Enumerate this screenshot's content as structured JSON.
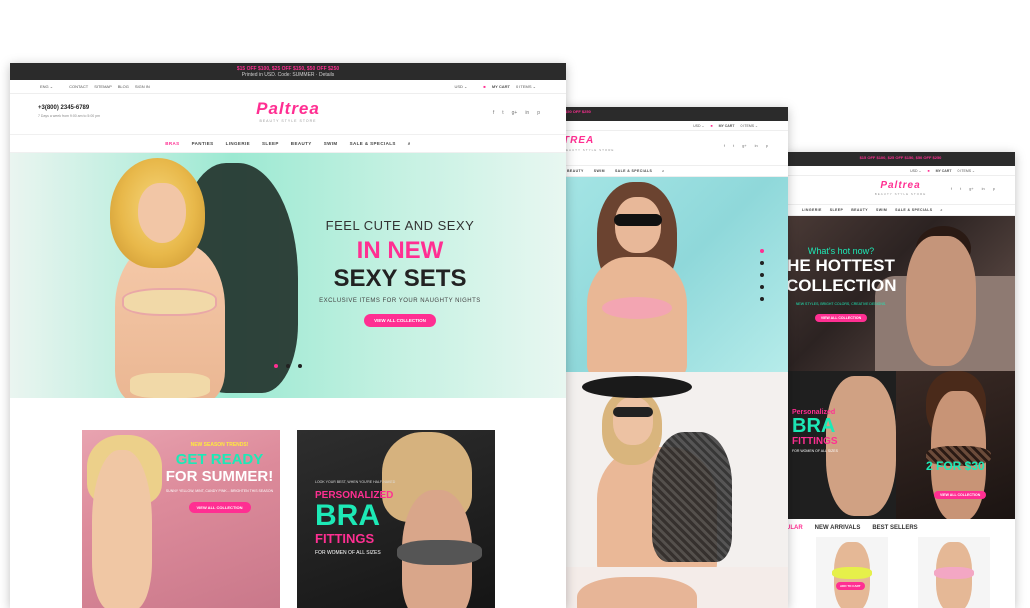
{
  "front": {
    "promo": "$15 OFF $100, $25 OFF $150, $50 OFF $250",
    "promo_sub": "Printed in USD. Code: SUMMER · Details",
    "util": [
      "ENG ⌄",
      "CONTACT",
      "SITEMAP",
      "BLOG",
      "SIGN IN",
      "USD ⌄",
      "MY CART",
      "0 ITEMS ⌄"
    ],
    "phone": "+3(800) 2345-6789",
    "phone_sub": "7 Days a week from 9:00 am to 5:00 pm",
    "logo": "Paltrea",
    "tagline": "BEAUTY STYLE STORE",
    "socials": [
      "f",
      "t",
      "g+",
      "in",
      "p"
    ],
    "nav": [
      "BRAS",
      "PANTIES",
      "LINGERIE",
      "SLEEP",
      "BEAUTY",
      "SWIM",
      "SALE & SPECIALS"
    ],
    "hero": {
      "line1": "FEEL CUTE AND SEXY",
      "line2": "IN NEW",
      "line3": "SEXY SETS",
      "line4": "EXCLUSIVE ITEMS FOR YOUR NAUGHTY NIGHTS",
      "button": "VIEW ALL COLLECTION"
    },
    "banner1": {
      "t1": "NEW SEASON TRENDS!",
      "t2": "GET READY",
      "t3": "FOR SUMMER!",
      "t4": "SUNNY YELLOW, MINT, CANDY PINK... BRIGHTEN THIS SEASON",
      "button": "VIEW ALL COLLECTION"
    },
    "banner2": {
      "t1": "LOOK YOUR BEST, WHEN YOU'RE HALF-NAKED",
      "t2": "PERSONALIZED",
      "t3": "BRA",
      "t4": "FITTINGS",
      "t5": "FOR WOMEN OF ALL SIZES"
    }
  },
  "middle": {
    "promo": "$50 OFF $250",
    "util": [
      "USD ⌄",
      "MY CART",
      "0 ITEMS ⌄"
    ],
    "logo": "TREA",
    "tagline": "BEAUTY STYLE STORE",
    "socials": [
      "f",
      "t",
      "g+",
      "in",
      "p"
    ],
    "nav": [
      "BEAUTY",
      "SWIM",
      "SALE & SPECIALS"
    ]
  },
  "back": {
    "promo": "$15 OFF $100, $25 OFF $150, $50 OFF $250",
    "util": [
      "USD ⌄",
      "MY CART",
      "0 ITEMS ⌄"
    ],
    "logo": "Paltrea",
    "tagline": "BEAUTY STYLE STORE",
    "socials": [
      "f",
      "t",
      "g+",
      "in",
      "p"
    ],
    "nav": [
      "LINGERIE",
      "SLEEP",
      "BEAUTY",
      "SWIM",
      "SALE & SPECIALS"
    ],
    "hero": {
      "t1": "What's hot now?",
      "t2a": "HE HOTTEST",
      "t2b": "COLLECTION",
      "t3": "NEW STYLES, BRIGHT COLORS, CREATIVE DESIGNS.",
      "button": "VIEW ALL COLLECTION"
    },
    "promo_left": {
      "t1": "Personalized",
      "t2": "BRA",
      "t3": "FITTINGS",
      "t4": "FOR WOMEN OF ALL SIZES"
    },
    "promo_right": {
      "t1": "2 FOR $30",
      "button": "VIEW ALL COLLECTION"
    },
    "tabs": [
      "ULAR",
      "NEW ARRIVALS",
      "BEST SELLERS"
    ],
    "product_button": "ADD TO CART"
  },
  "colors": {
    "accent": "#ff2f92",
    "mint": "#1de9b6",
    "promo_bar": "#2b2b2b"
  }
}
